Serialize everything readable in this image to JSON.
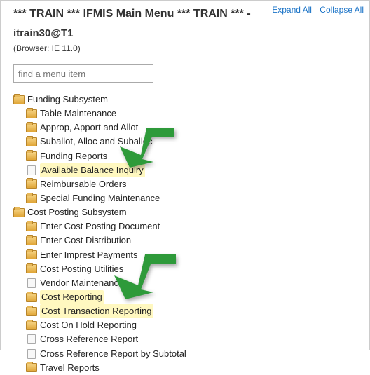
{
  "header": {
    "title": "*** TRAIN *** IFMIS Main Menu *** TRAIN *** -",
    "user": "itrain30@T1",
    "browser": "(Browser: IE 11.0)",
    "expand": "Expand All",
    "collapse": "Collapse All"
  },
  "search": {
    "placeholder": "find a menu item"
  },
  "tree": [
    {
      "icon": "folder",
      "indent": 0,
      "label": "Funding Subsystem",
      "interact": true
    },
    {
      "icon": "folder",
      "indent": 1,
      "label": "Table Maintenance",
      "interact": true
    },
    {
      "icon": "folder",
      "indent": 1,
      "label": "Approp, Apport and Allot",
      "interact": true
    },
    {
      "icon": "folder",
      "indent": 1,
      "label": "Suballot, Alloc and Suballoc",
      "interact": true
    },
    {
      "icon": "folder",
      "indent": 1,
      "label": "Funding Reports",
      "interact": true
    },
    {
      "icon": "doc",
      "indent": 1,
      "label": "Available Balance Inquiry",
      "interact": true,
      "highlight": true
    },
    {
      "icon": "folder",
      "indent": 1,
      "label": "Reimbursable Orders",
      "interact": true
    },
    {
      "icon": "folder",
      "indent": 1,
      "label": "Special Funding Maintenance",
      "interact": true
    },
    {
      "icon": "folder",
      "indent": 0,
      "label": "Cost Posting Subsystem",
      "interact": true
    },
    {
      "icon": "folder",
      "indent": 1,
      "label": "Enter Cost Posting Document",
      "interact": true
    },
    {
      "icon": "folder",
      "indent": 1,
      "label": "Enter Cost Distribution",
      "interact": true
    },
    {
      "icon": "folder",
      "indent": 1,
      "label": "Enter Imprest Payments",
      "interact": true
    },
    {
      "icon": "folder",
      "indent": 1,
      "label": "Cost Posting Utilities",
      "interact": true
    },
    {
      "icon": "doc",
      "indent": 1,
      "label": "Vendor Maintenance",
      "interact": true
    },
    {
      "icon": "folder",
      "indent": 1,
      "label": "Cost Reporting",
      "interact": true,
      "highlight": true
    },
    {
      "icon": "folder",
      "indent": 1,
      "label": "Cost Transaction Reporting",
      "interact": true,
      "highlight": true
    },
    {
      "icon": "folder",
      "indent": 1,
      "label": "Cost On Hold Reporting",
      "interact": true
    },
    {
      "icon": "doc",
      "indent": 1,
      "label": "Cross Reference Report",
      "interact": true
    },
    {
      "icon": "doc",
      "indent": 1,
      "label": "Cross Reference Report by Subtotal",
      "interact": true
    },
    {
      "icon": "folder",
      "indent": 1,
      "label": "Travel Reports",
      "interact": true
    }
  ]
}
